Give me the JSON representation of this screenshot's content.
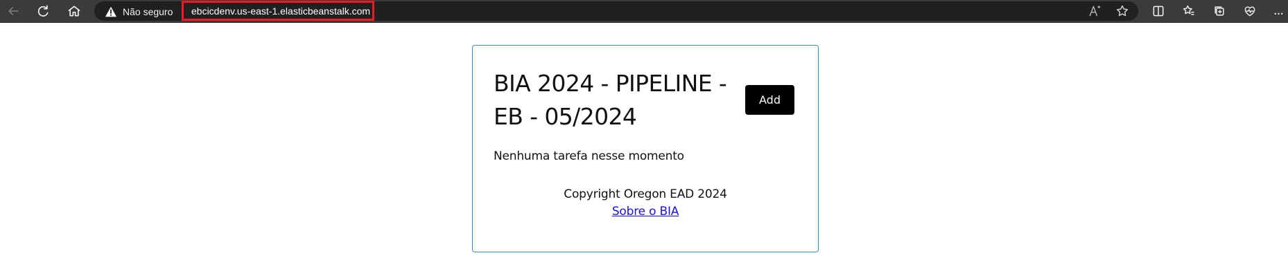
{
  "browser": {
    "security_label": "Não seguro",
    "url": "ebcicdenv.us-east-1.elasticbeanstalk.com",
    "read_aloud_text": "A",
    "more_text": "...",
    "colors": {
      "bar_background": "#3b3b3b",
      "address_background": "#202020",
      "highlight_border": "#ee1b24"
    },
    "icons": [
      "back-arrow-icon",
      "reload-icon",
      "home-icon",
      "warning-icon",
      "read-aloud-icon",
      "favorite-star-icon",
      "split-screen-icon",
      "favorites-icon",
      "collections-icon",
      "performance-heart-icon",
      "more-icon"
    ]
  },
  "page": {
    "title": "BIA 2024 - PIPELINE - EB - 05/2024",
    "add_label": "Add",
    "empty_message": "Nenhuma tarefa nesse momento",
    "copyright": "Copyright Oregon EAD 2024",
    "about_link": "Sobre o BIA",
    "colors": {
      "card_border": "#3a87c8",
      "button_background": "#000000",
      "link": "#1a0dff"
    }
  }
}
